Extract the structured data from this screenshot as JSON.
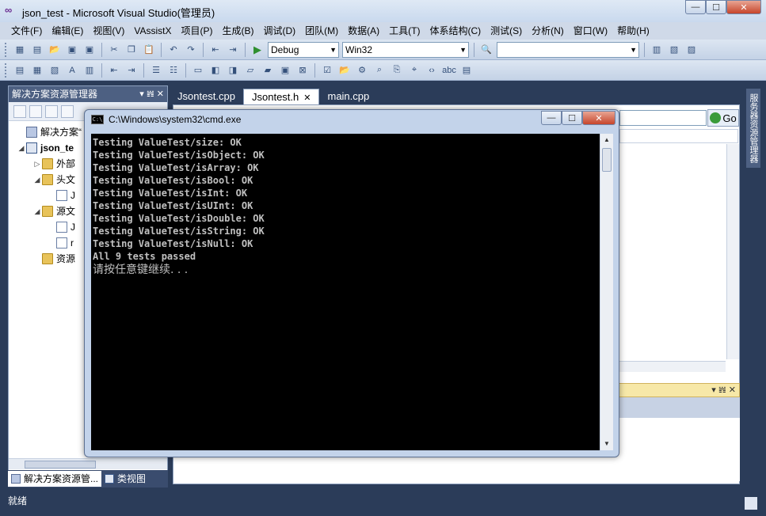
{
  "window": {
    "title": "json_test - Microsoft Visual Studio(管理员)",
    "minimize": "—",
    "maximize": "☐",
    "close": "✕"
  },
  "menu": [
    "文件(F)",
    "编辑(E)",
    "视图(V)",
    "VAssistX",
    "项目(P)",
    "生成(B)",
    "调试(D)",
    "团队(M)",
    "数据(A)",
    "工具(T)",
    "体系结构(C)",
    "测试(S)",
    "分析(N)",
    "窗口(W)",
    "帮助(H)"
  ],
  "toolbar": {
    "config": "Debug",
    "platform": "Win32",
    "search_value": ""
  },
  "solution_explorer": {
    "title": "解决方案资源管理器",
    "header_buttons": "▾ 𝍀 ✕",
    "tree": [
      {
        "label": "解决方案“",
        "indent": 0,
        "exp": "",
        "icon": "sol"
      },
      {
        "label": "json_te",
        "indent": 1,
        "exp": "◢",
        "icon": "proj",
        "bold": true
      },
      {
        "label": "外部",
        "indent": 2,
        "exp": "▷",
        "icon": "folder"
      },
      {
        "label": "头文",
        "indent": 2,
        "exp": "◢",
        "icon": "folder"
      },
      {
        "label": "J",
        "indent": 3,
        "exp": "",
        "icon": "file"
      },
      {
        "label": "源文",
        "indent": 2,
        "exp": "◢",
        "icon": "folder"
      },
      {
        "label": "J",
        "indent": 3,
        "exp": "",
        "icon": "file"
      },
      {
        "label": "r",
        "indent": 3,
        "exp": "",
        "icon": "file"
      },
      {
        "label": "资源",
        "indent": 2,
        "exp": "",
        "icon": "folder"
      }
    ],
    "tabs": [
      "解决方案资源管...",
      "类视图"
    ]
  },
  "doc_tabs": [
    {
      "label": "Jsontest.cpp",
      "active": false
    },
    {
      "label": "Jsontest.h",
      "active": true
    },
    {
      "label": "main.cpp",
      "active": false
    }
  ],
  "editor": {
    "go_label": "Go"
  },
  "output_panel": {
    "header_buttons": "▾ 𝍀 ✕"
  },
  "right_sidebar": {
    "tab_label": "服务器资源管理器"
  },
  "status": {
    "text": "就绪"
  },
  "cmd": {
    "title": "C:\\Windows\\system32\\cmd.exe",
    "lines": [
      "Testing ValueTest/size: OK",
      "Testing ValueTest/isObject: OK",
      "Testing ValueTest/isArray: OK",
      "Testing ValueTest/isBool: OK",
      "Testing ValueTest/isInt: OK",
      "Testing ValueTest/isUInt: OK",
      "Testing ValueTest/isDouble: OK",
      "Testing ValueTest/isString: OK",
      "Testing ValueTest/isNull: OK",
      "All 9 tests passed"
    ],
    "prompt": "请按任意键继续. . ."
  }
}
